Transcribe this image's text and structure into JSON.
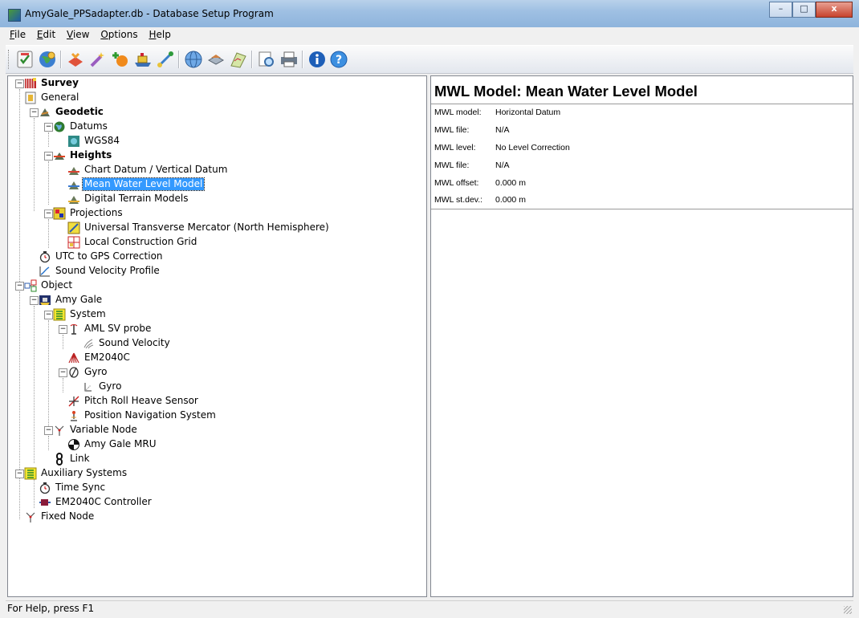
{
  "window": {
    "title": "AmyGale_PPSadapter.db - Database Setup Program",
    "buttons": {
      "minimize": "–",
      "maximize": "□",
      "close": "x"
    }
  },
  "menu": [
    "File",
    "Edit",
    "View",
    "Options",
    "Help"
  ],
  "toolbar": {
    "icons": [
      "checklist-icon",
      "globe-settings-icon",
      "survey-icon",
      "wand-icon",
      "add-node-icon",
      "vessel-icon",
      "link-icon",
      "world-icon",
      "layers-icon",
      "chart-icon",
      "search-document-icon",
      "printer-icon",
      "info-icon",
      "help-icon"
    ]
  },
  "tree": {
    "items": [
      {
        "label": "Survey",
        "icon": "survey-icon",
        "bold": true
      },
      {
        "label": "General",
        "icon": "general-icon"
      },
      {
        "label": "Geodetic",
        "icon": "geodetic-icon",
        "bold": true
      },
      {
        "label": "Datums",
        "icon": "datums-icon"
      },
      {
        "label": "WGS84",
        "icon": "datum-icon"
      },
      {
        "label": "Heights",
        "icon": "heights-icon",
        "bold": true
      },
      {
        "label": "Chart Datum / Vertical Datum",
        "icon": "height-model-icon"
      },
      {
        "label": "Mean Water Level Model",
        "icon": "height-model-icon",
        "selected": true
      },
      {
        "label": "Digital Terrain Models",
        "icon": "height-model-icon"
      },
      {
        "label": "Projections",
        "icon": "projections-icon"
      },
      {
        "label": "Universal Transverse Mercator (North Hemisphere)",
        "icon": "projection-icon"
      },
      {
        "label": "Local Construction Grid",
        "icon": "grid-icon"
      },
      {
        "label": "UTC to GPS Correction",
        "icon": "clock-icon"
      },
      {
        "label": "Sound Velocity Profile",
        "icon": "profile-icon"
      },
      {
        "label": "Object",
        "icon": "object-icon"
      },
      {
        "label": "Amy Gale",
        "icon": "vessel-icon"
      },
      {
        "label": "System",
        "icon": "system-icon"
      },
      {
        "label": "AML SV probe",
        "icon": "probe-icon"
      },
      {
        "label": "Sound Velocity",
        "icon": "sound-velocity-icon"
      },
      {
        "label": "EM2040C",
        "icon": "multibeam-icon"
      },
      {
        "label": "Gyro",
        "icon": "gyro-icon"
      },
      {
        "label": "Gyro",
        "icon": "gyro-sub-icon"
      },
      {
        "label": "Pitch Roll Heave Sensor",
        "icon": "prh-icon"
      },
      {
        "label": "Position Navigation System",
        "icon": "nav-icon"
      },
      {
        "label": "Variable Node",
        "icon": "node-icon"
      },
      {
        "label": "Amy Gale MRU",
        "icon": "mru-icon"
      },
      {
        "label": "Link",
        "icon": "link-icon"
      },
      {
        "label": "Auxiliary Systems",
        "icon": "system-icon"
      },
      {
        "label": "Time Sync",
        "icon": "clock-icon"
      },
      {
        "label": "EM2040C Controller",
        "icon": "controller-icon"
      },
      {
        "label": "Fixed Node",
        "icon": "node-icon"
      }
    ]
  },
  "detail": {
    "title": "MWL Model: Mean Water Level Model",
    "properties": [
      {
        "key": "MWL model:",
        "value": "Horizontal Datum"
      },
      {
        "key": "MWL file:",
        "value": "N/A"
      },
      {
        "key": "MWL level:",
        "value": "No Level Correction"
      },
      {
        "key": "MWL file:",
        "value": "N/A"
      },
      {
        "key": "MWL offset:",
        "value": "0.000 m"
      },
      {
        "key": "MWL st.dev.:",
        "value": "0.000 m"
      }
    ]
  },
  "status": {
    "text": "For Help, press F1"
  }
}
